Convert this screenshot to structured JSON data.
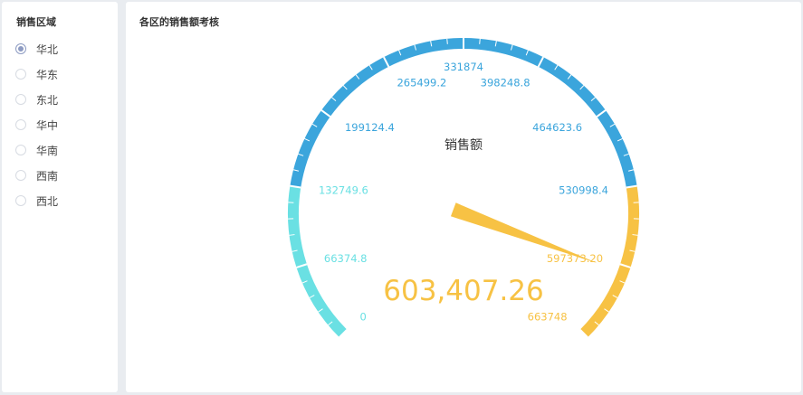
{
  "filter": {
    "title": "销售区域",
    "selected_index": 0,
    "options": [
      "华北",
      "华东",
      "东北",
      "华中",
      "华南",
      "西南",
      "西北"
    ]
  },
  "chart": {
    "panel_title": "各区的销售额考核",
    "series_name": "销售额",
    "value_display": "603,407.26",
    "colors": {
      "low": "#6ae0e3",
      "mid": "#3ba5dc",
      "high": "#f7c244",
      "pointer": "#f7c244"
    }
  },
  "chart_data": {
    "type": "gauge",
    "min": 0,
    "max": 663748,
    "value": 603407.26,
    "start_angle_deg": 225,
    "end_angle_deg": -45,
    "axis_labels": [
      "0",
      "66374.8",
      "132749.6",
      "199124.4",
      "265499.2",
      "331874",
      "398248.8",
      "464623.6",
      "530998.4",
      "597373.20",
      "663748"
    ],
    "color_bands": [
      {
        "to_fraction": 0.2,
        "color": "#6ae0e3"
      },
      {
        "to_fraction": 0.8,
        "color": "#3ba5dc"
      },
      {
        "to_fraction": 1.0,
        "color": "#f7c244"
      }
    ]
  }
}
